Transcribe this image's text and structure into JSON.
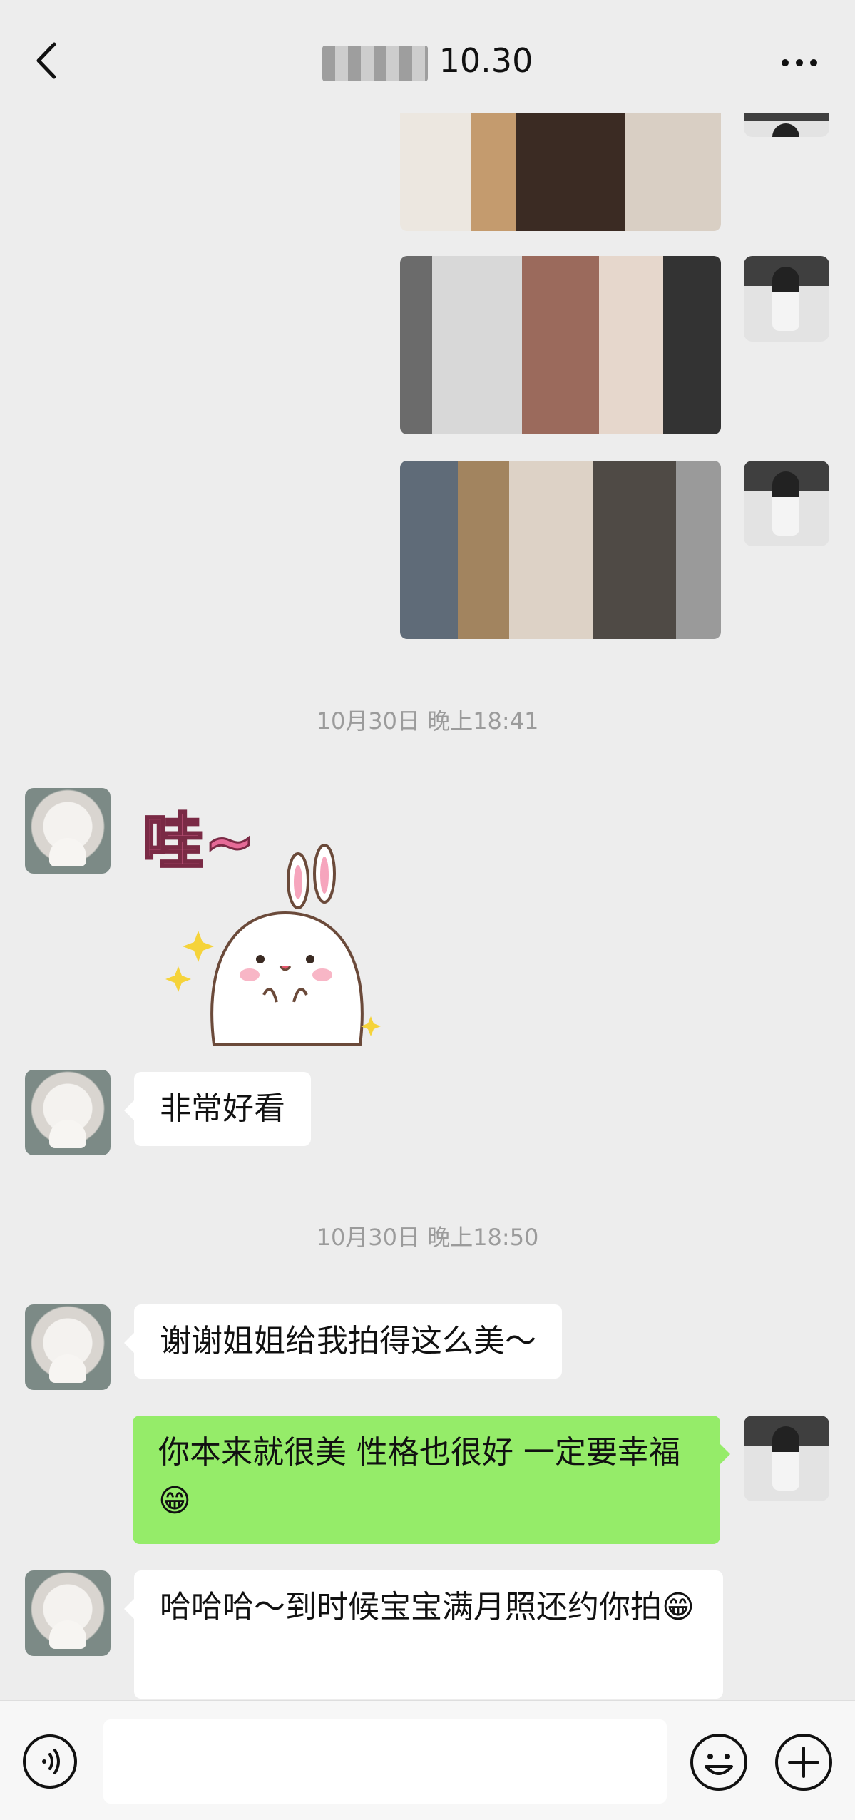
{
  "header": {
    "title": "10.30",
    "back_icon": "chevron-left-icon",
    "more_icon": "more-dots-icon"
  },
  "messages": {
    "timestamp_1": "10月30日 晚上18:41",
    "timestamp_2": "10月30日 晚上18:50",
    "sticker_text": "哇~",
    "msg_1": "非常好看",
    "msg_2": "谢谢姐姐给我拍得这么美～",
    "msg_3": "你本来就很美 性格也很好 一定要幸福😁",
    "msg_4": "哈哈哈～到时候宝宝满月照还约你拍😁"
  },
  "colors": {
    "background": "#ededed",
    "self_bubble": "#95ec69",
    "other_bubble": "#ffffff",
    "timestamp": "#9b9b9b"
  },
  "bottom_bar": {
    "voice_icon": "voice-icon",
    "emoji_icon": "emoji-icon",
    "plus_icon": "plus-icon",
    "input_value": ""
  }
}
